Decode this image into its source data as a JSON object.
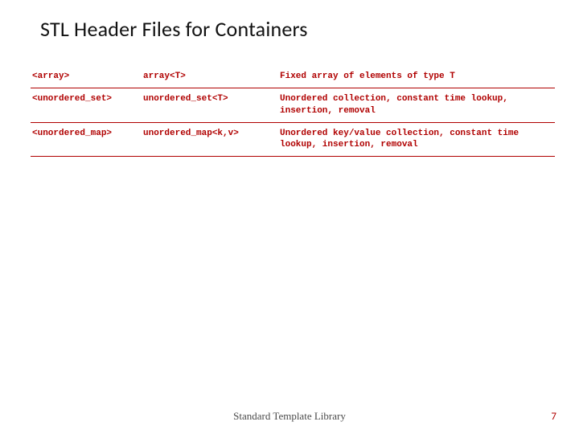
{
  "title": "STL Header Files for Containers",
  "rows": [
    {
      "header": "<array>",
      "template": "array<T>",
      "desc": "Fixed array of elements of type T"
    },
    {
      "header": "<unordered_set>",
      "template": "unordered_set<T>",
      "desc": "Unordered collection, constant time lookup, insertion, removal"
    },
    {
      "header": "<unordered_map>",
      "template": "unordered_map<k,v>",
      "desc": "Unordered key/value collection, constant time lookup, insertion, removal"
    }
  ],
  "footer": {
    "center": "Standard Template Library",
    "page": "7"
  },
  "colors": {
    "accent": "#b00000"
  }
}
